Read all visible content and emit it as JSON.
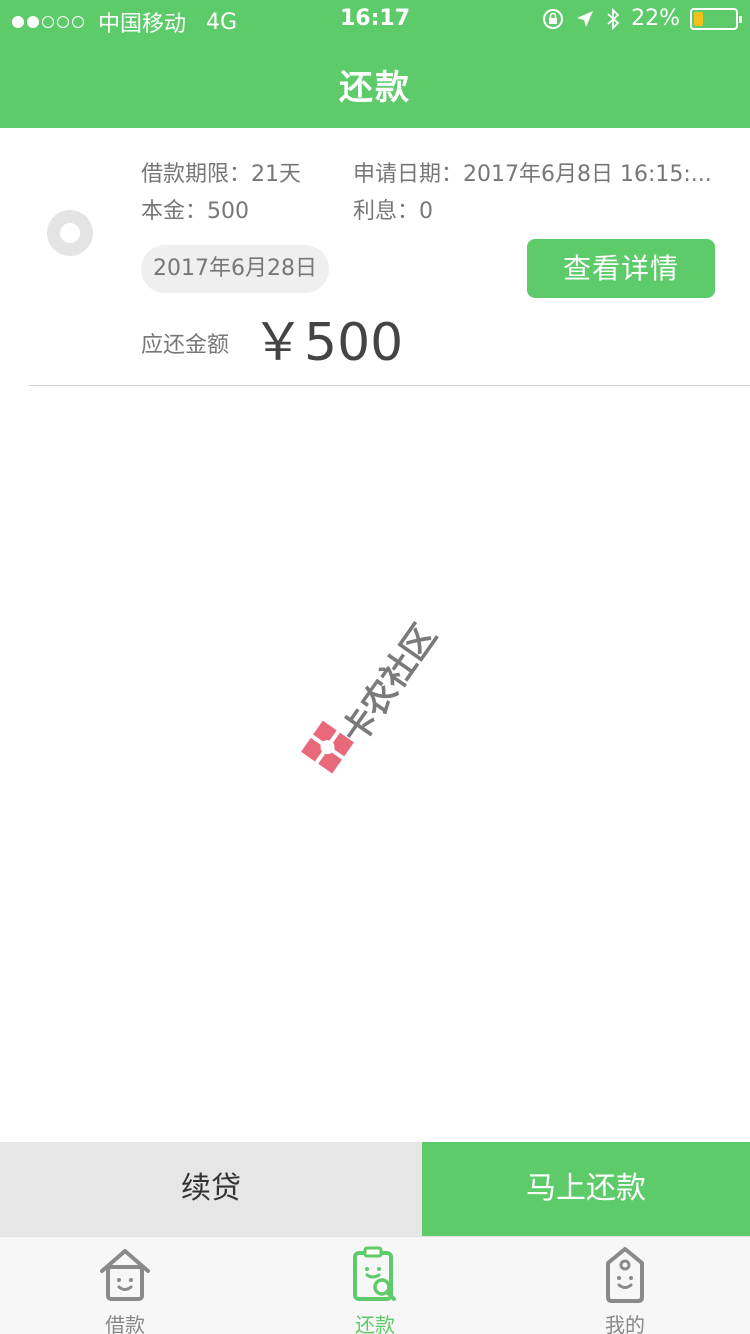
{
  "status_bar": {
    "carrier": "中国移动",
    "network": "4G",
    "time": "16:17",
    "battery": "22%",
    "battery_level": 0.22,
    "battery_color": "#f2c21a"
  },
  "nav": {
    "title": "还款"
  },
  "loan": {
    "term_label": "借款期限：",
    "term_value": "21天",
    "apply_date_label": "申请日期：",
    "apply_date_value": "2017年6月8日 16:15:...",
    "principal_label": "本金：",
    "principal_value": "500",
    "interest_label": "利息：",
    "interest_value": "0",
    "due_date": "2017年6月28日",
    "detail_button": "查看详情",
    "due_amount_label": "应还金额",
    "due_amount": "￥500"
  },
  "watermark": {
    "text": "卡农社区"
  },
  "actions": {
    "renew_label": "续贷",
    "repay_label": "马上还款"
  },
  "tabs": [
    {
      "label": "借款",
      "icon": "house-face-icon",
      "active": false
    },
    {
      "label": "还款",
      "icon": "clipboard-search-icon",
      "active": true
    },
    {
      "label": "我的",
      "icon": "tag-face-icon",
      "active": false
    }
  ],
  "colors": {
    "brand_green": "#5ecb6b",
    "gray_bar": "#e6e6e6"
  }
}
